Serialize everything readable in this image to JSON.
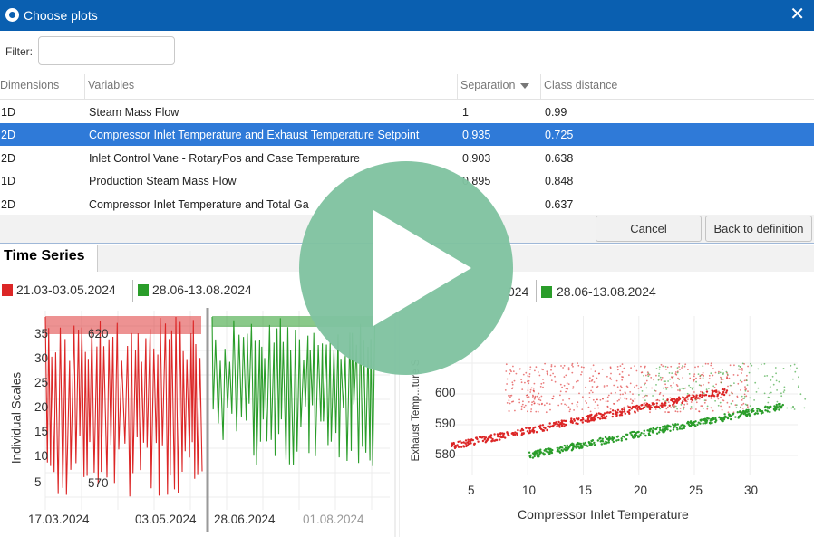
{
  "window": {
    "title": "Choose plots",
    "close_icon": "close-icon"
  },
  "filter": {
    "label": "Filter:",
    "value": "",
    "placeholder": ""
  },
  "table": {
    "headers": [
      "Dimensions",
      "Variables",
      "Separation",
      "Class distance"
    ],
    "rows": [
      {
        "dim": "1D",
        "vars": "Steam Mass Flow",
        "sep": "1",
        "dist": "0.99"
      },
      {
        "dim": "2D",
        "vars": "Compressor Inlet Temperature and Exhaust Temperature Setpoint",
        "sep": "0.935",
        "dist": "0.725"
      },
      {
        "dim": "2D",
        "vars": "Inlet Control Vane - RotaryPos and Case Temperature",
        "sep": "0.903",
        "dist": "0.638"
      },
      {
        "dim": "1D",
        "vars": "Production Steam Mass Flow",
        "sep": "0.895",
        "dist": "0.848"
      },
      {
        "dim": "2D",
        "vars": "Compressor Inlet Temperature and Total Ga",
        "sep": "",
        "dist": "0.637"
      }
    ],
    "selected_index": 1
  },
  "buttons": {
    "cancel": "Cancel",
    "back": "Back to definition"
  },
  "tabs": {
    "time_series": "Time Series"
  },
  "colors": {
    "red": "#dc2626",
    "green": "#2a9d2a",
    "accent": "#0a5fb0",
    "selection": "#2f7ad8",
    "play": "#80c3a0"
  },
  "legend": {
    "left": [
      {
        "label": "21.03-03.05.2024",
        "color": "#dc2626"
      },
      {
        "label": "28.06-13.08.2024",
        "color": "#2a9d2a"
      }
    ],
    "right": [
      {
        "label": "024",
        "color": "#dc2626"
      },
      {
        "label": "28.06-13.08.2024",
        "color": "#2a9d2a"
      }
    ]
  },
  "chart_data": [
    {
      "type": "line",
      "ylabel": "Individual Scales",
      "yticks": [
        "35",
        "30",
        "25",
        "20",
        "15",
        "10",
        "5"
      ],
      "inner_labels": [
        "620",
        "570"
      ],
      "xticks_left": [
        "17.03.2024",
        "03.05.2024"
      ],
      "xticks_right": [
        "28.06.2024",
        "01.08.2024"
      ],
      "series": [
        {
          "name": "21.03-03.05.2024",
          "color": "#dc2626"
        },
        {
          "name": "28.06-13.08.2024",
          "color": "#2a9d2a"
        }
      ]
    },
    {
      "type": "scatter",
      "xlabel": "Compressor Inlet Temperature",
      "ylabel": "Exhaust Temp...ture S",
      "xticks": [
        5,
        10,
        15,
        20,
        25,
        30
      ],
      "yticks": [
        580,
        590,
        600
      ],
      "series": [
        {
          "name": "21.03-03.05.2024",
          "color": "#dc2626",
          "trend": [
            [
              3,
              583
            ],
            [
              28,
              601
            ]
          ]
        },
        {
          "name": "28.06-13.08.2024",
          "color": "#2a9d2a",
          "trend": [
            [
              10,
              580
            ],
            [
              33,
              596
            ]
          ]
        }
      ]
    }
  ],
  "play_icon": "play-icon"
}
